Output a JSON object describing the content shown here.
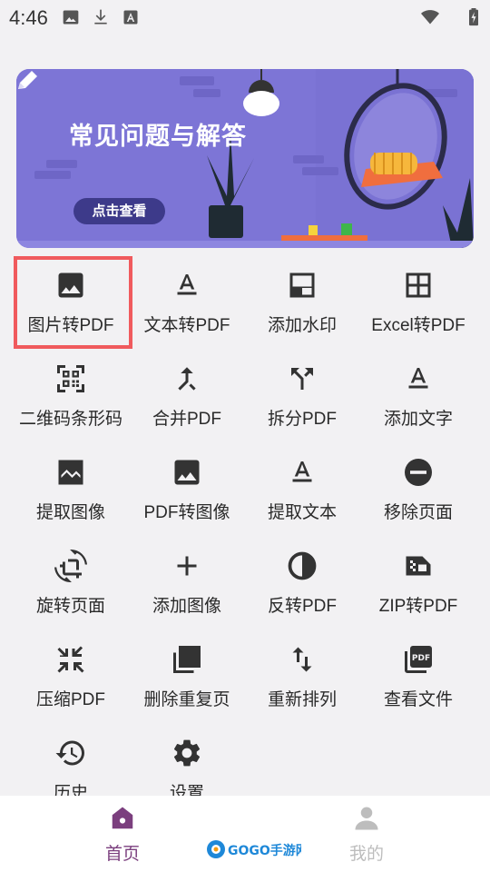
{
  "status_bar": {
    "time": "4:46",
    "icons": [
      "image-icon",
      "download-icon",
      "font-icon",
      "wifi-icon",
      "battery-icon"
    ]
  },
  "banner": {
    "title": "常见问题与解答",
    "button_label": "点击查看"
  },
  "tools": [
    {
      "label": "图片转PDF",
      "icon": "image-icon"
    },
    {
      "label": "文本转PDF",
      "icon": "text-format-icon"
    },
    {
      "label": "添加水印",
      "icon": "watermark-icon"
    },
    {
      "label": "Excel转PDF",
      "icon": "grid-icon"
    },
    {
      "label": "二维码条形码",
      "icon": "qr-code-icon"
    },
    {
      "label": "合并PDF",
      "icon": "merge-icon"
    },
    {
      "label": "拆分PDF",
      "icon": "split-icon"
    },
    {
      "label": "添加文字",
      "icon": "text-format-icon"
    },
    {
      "label": "提取图像",
      "icon": "landscape-icon"
    },
    {
      "label": "PDF转图像",
      "icon": "image-icon"
    },
    {
      "label": "提取文本",
      "icon": "text-format-icon"
    },
    {
      "label": "移除页面",
      "icon": "remove-circle-icon"
    },
    {
      "label": "旋转页面",
      "icon": "rotate-icon"
    },
    {
      "label": "添加图像",
      "icon": "plus-icon"
    },
    {
      "label": "反转PDF",
      "icon": "contrast-icon"
    },
    {
      "label": "ZIP转PDF",
      "icon": "zip-icon"
    },
    {
      "label": "压缩PDF",
      "icon": "compress-icon"
    },
    {
      "label": "删除重复页",
      "icon": "duplicate-pages-icon"
    },
    {
      "label": "重新排列",
      "icon": "swap-vertical-icon"
    },
    {
      "label": "查看文件",
      "icon": "pdf-file-icon"
    },
    {
      "label": "历史",
      "icon": "history-icon"
    },
    {
      "label": "设置",
      "icon": "gear-icon"
    }
  ],
  "nav": {
    "home_label": "首页",
    "mine_label": "我的"
  },
  "watermark_text": "GOGO手游网",
  "colors": {
    "accent": "#7b3f7e",
    "highlight": "#f05a5d",
    "banner": "#7d75d6",
    "inactive": "#bdbdbd"
  }
}
